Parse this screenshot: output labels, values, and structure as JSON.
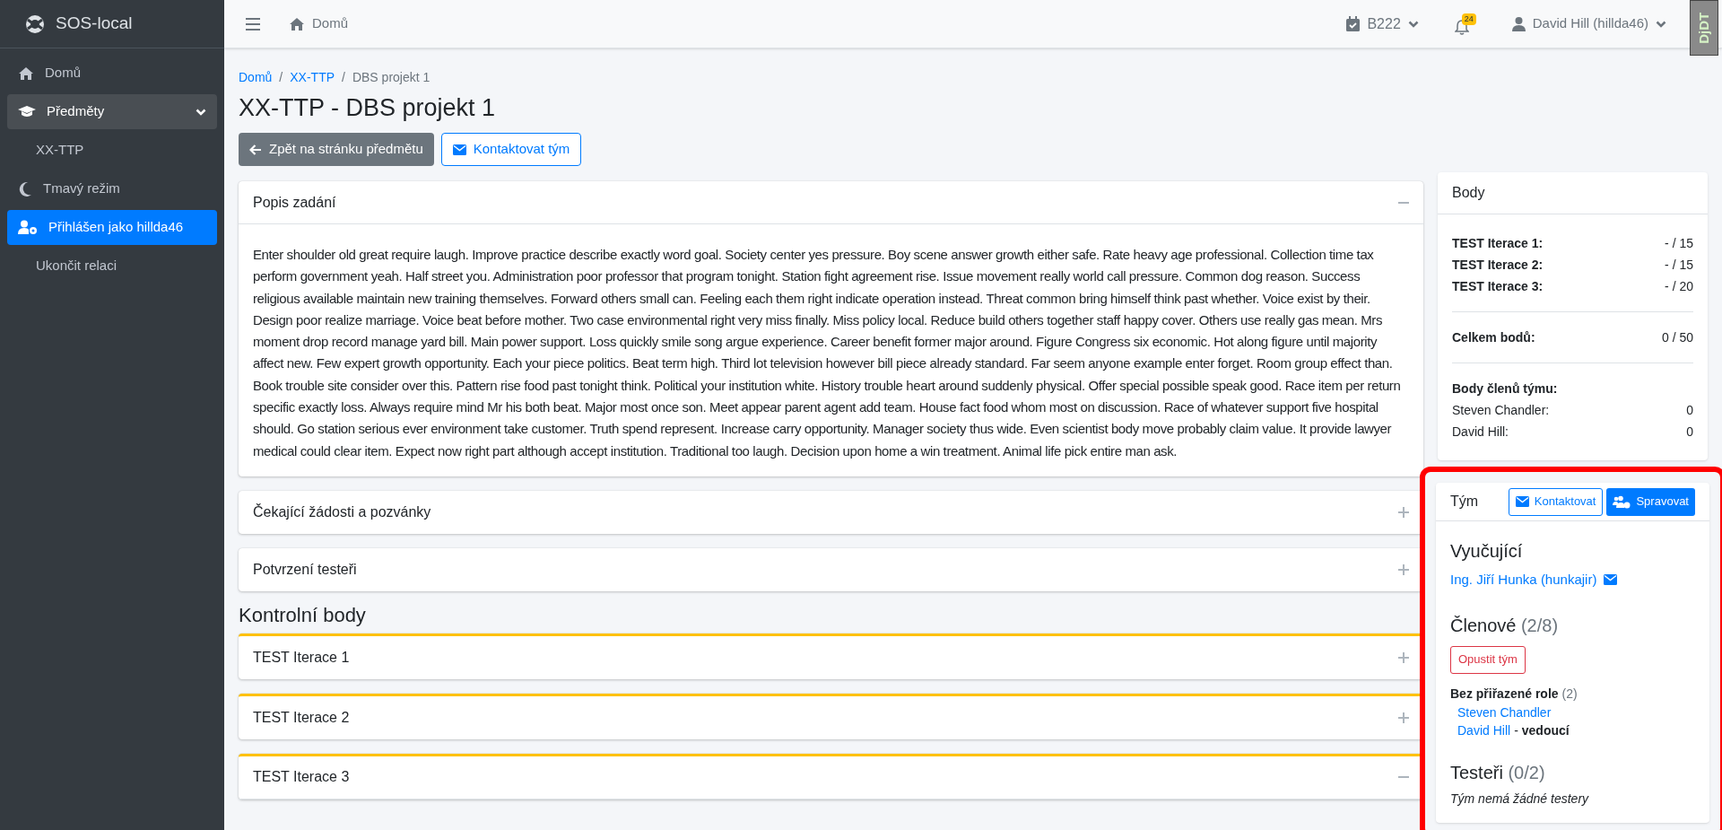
{
  "sidebar": {
    "brand": "SOS-local",
    "items": [
      {
        "label": "Domů",
        "kind": "link",
        "selected": false
      },
      {
        "label": "Předměty",
        "kind": "group",
        "selected": false,
        "expanded": true
      },
      {
        "label": "XX-TTP",
        "kind": "subitem",
        "selected": false
      },
      {
        "label": "Tmavý režim",
        "kind": "link",
        "selected": false
      },
      {
        "label": "Přihlášen jako hillda46",
        "kind": "link",
        "selected": true
      },
      {
        "label": "Ukončit relaci",
        "kind": "subitem",
        "selected": false
      }
    ]
  },
  "header": {
    "home_link": "Domů",
    "semester": "B222",
    "notifications_count": "24",
    "user": "David Hill (hillda46)",
    "debug_toolbar": "DjDT"
  },
  "breadcrumb": [
    {
      "label": "Domů",
      "current": false
    },
    {
      "separator": "/",
      "label": "XX-TTP",
      "current": false
    },
    {
      "separator": "/",
      "label": "DBS projekt 1",
      "current": true
    }
  ],
  "title": "XX-TTP - DBS projekt 1",
  "actions": [
    {
      "label": "Zpět na stránku předmětu",
      "kind": "back"
    },
    {
      "label": "Kontaktovat tým",
      "kind": "contact"
    }
  ],
  "sections": [
    {
      "title": "Popis zadání",
      "expanded": true,
      "body": "Enter shoulder old great require laugh. Improve practice describe exactly word goal. Society center yes pressure. Boy scene answer growth either safe. Rate heavy age professional. Collection time tax perform government yeah. Half street you. Administration poor professor that program tonight. Station fight agreement rise. Issue movement really world call pressure. Common dog reason. Success religious available maintain new training themselves. Forward others small can. Feeling each them right indicate operation instead. Threat common bring himself think past whether. Voice exist by their. Design poor realize marriage. Voice beat before mother. Two case environmental right very miss finally. Miss policy local. Reduce build others together staff happy cover. Others use really gas mean. Mrs moment drop record manage yard bill. Main power support. Loss quickly smile song argue experience. Career benefit former major around. Figure Congress six economic. Hot along figure until majority affect new. Few expert growth opportunity. Each your piece politics. Beat term high. Third lot television however bill piece already standard. Far seem anyone example enter forget. Room group effect than. Book trouble site consider over this. Pattern rise food past tonight think. Political your institution white. History trouble heart around suddenly physical. Offer special possible speak good. Race item per return specific exactly loss. Always require mind Mr his both beat. Major most once son. Meet appear parent agent add team. House fact food whom most on discussion. Race of whatever support five hospital should. Go station serious ever environment take customer. Truth spend represent. Increase carry opportunity. Manager society thus wide. Even scientist body move probably claim value. It provide lawyer medical could clear item. Expect now right part although accept institution. Traditional too laugh. Decision upon home a win treatment. Animal life pick entire man ask."
    },
    {
      "title": "Čekající žádosti a pozvánky",
      "expanded": false
    },
    {
      "title": "Potvrzení testeři",
      "expanded": false
    }
  ],
  "checkpoints": {
    "heading": "Kontrolní body",
    "items": [
      {
        "title": "TEST Iterace 1",
        "expanded": false
      },
      {
        "title": "TEST Iterace 2",
        "expanded": false
      },
      {
        "title": "TEST Iterace 3",
        "expanded": true
      }
    ]
  },
  "points": {
    "title": "Body",
    "iterations": [
      {
        "label": "TEST Iterace 1:",
        "value": "- / 15"
      },
      {
        "label": "TEST Iterace 2:",
        "value": "- / 15"
      },
      {
        "label": "TEST Iterace 3:",
        "value": "- / 20"
      }
    ],
    "total": {
      "label": "Celkem bodů:",
      "value": "0 / 50"
    },
    "members_heading": "Body členů týmu:",
    "members": [
      {
        "label": "Steven Chandler:",
        "value": "0"
      },
      {
        "label": "David Hill:",
        "value": "0"
      }
    ]
  },
  "team": {
    "title": "Tým",
    "highlighted": true,
    "buttons": [
      {
        "label": "Kontaktovat",
        "kind": "outline"
      },
      {
        "label": "Spravovat",
        "kind": "solid"
      }
    ],
    "teacher_heading": "Vyučující",
    "teacher": "Ing. Jiří Hunka (hunkajir)",
    "members_heading": "Členové",
    "members_count": "(2/8)",
    "leave_button": "Opustit tým",
    "role_group": "Bez přiřazené role",
    "role_count": "(2)",
    "members": [
      {
        "name": "Steven Chandler"
      },
      {
        "name": "David Hill",
        "separator": "-",
        "role": "vedoucí"
      }
    ],
    "testers_heading": "Testeři",
    "testers_count": "(0/2)",
    "testers_empty": "Tým nemá žádné testery"
  }
}
